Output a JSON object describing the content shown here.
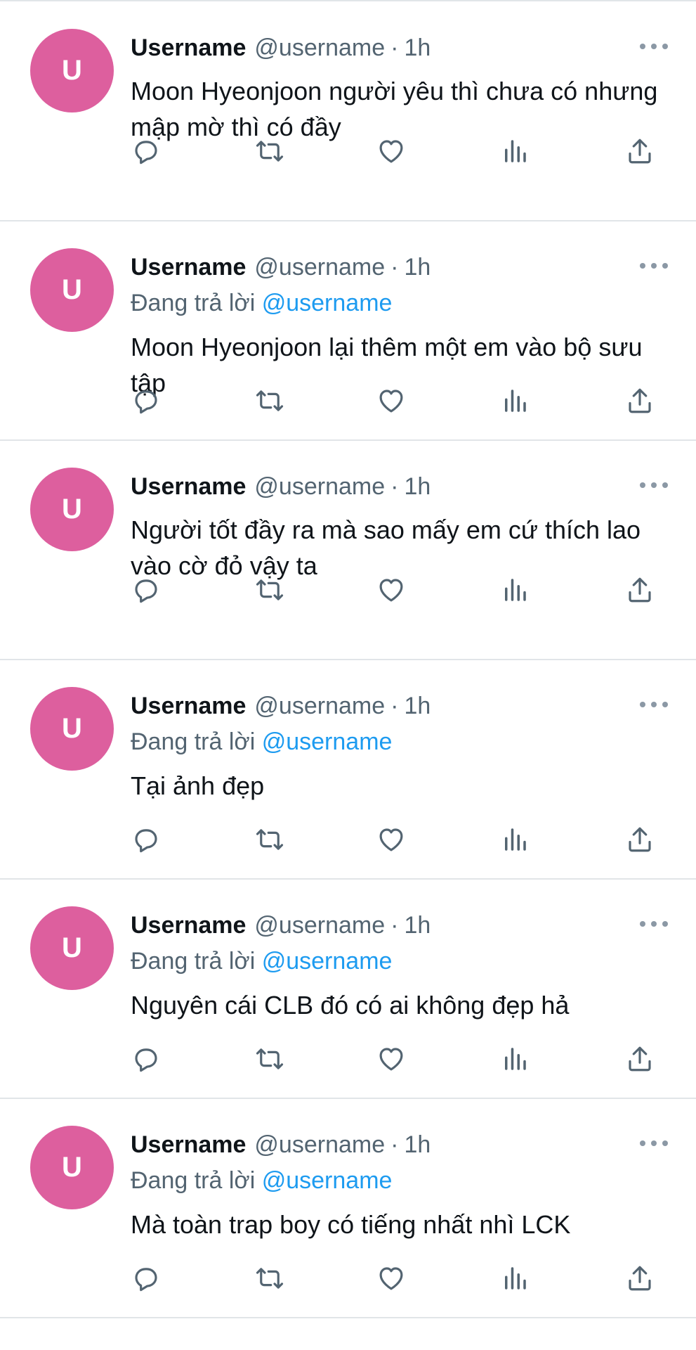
{
  "colors": {
    "avatar_bg": "#dd5f9e",
    "mention": "#1d9bf0",
    "secondary_text": "#536471",
    "divider": "#e1e5e8"
  },
  "tweets": [
    {
      "avatar_letter": "U",
      "display_name": "Username",
      "handle": "@username",
      "separator": "·",
      "time": "1h",
      "reply_prefix": "",
      "reply_to": "",
      "text": "Moon Hyeonjoon người yêu thì chưa có nhưng mập mờ thì có đầy"
    },
    {
      "avatar_letter": "U",
      "display_name": "Username",
      "handle": "@username",
      "separator": "·",
      "time": "1h",
      "reply_prefix": "Đang trả lời",
      "reply_to": "@username",
      "text": "Moon Hyeonjoon lại thêm một em vào bộ sưu tập"
    },
    {
      "avatar_letter": "U",
      "display_name": "Username",
      "handle": "@username",
      "separator": "·",
      "time": "1h",
      "reply_prefix": "",
      "reply_to": "",
      "text": "Người tốt đầy ra mà sao mấy em cứ thích lao vào cờ đỏ vậy ta"
    },
    {
      "avatar_letter": "U",
      "display_name": "Username",
      "handle": "@username",
      "separator": "·",
      "time": "1h",
      "reply_prefix": "Đang trả lời",
      "reply_to": "@username",
      "text": "Tại ảnh đẹp"
    },
    {
      "avatar_letter": "U",
      "display_name": "Username",
      "handle": "@username",
      "separator": "·",
      "time": "1h",
      "reply_prefix": "Đang trả lời",
      "reply_to": "@username",
      "text": "Nguyên cái CLB đó có ai không đẹp hả"
    },
    {
      "avatar_letter": "U",
      "display_name": "Username",
      "handle": "@username",
      "separator": "·",
      "time": "1h",
      "reply_prefix": "Đang trả lời",
      "reply_to": "@username",
      "text": "Mà toàn trap boy có tiếng nhất nhì LCK"
    }
  ],
  "action_icons": [
    "reply-icon",
    "retweet-icon",
    "like-icon",
    "views-icon",
    "share-icon"
  ]
}
